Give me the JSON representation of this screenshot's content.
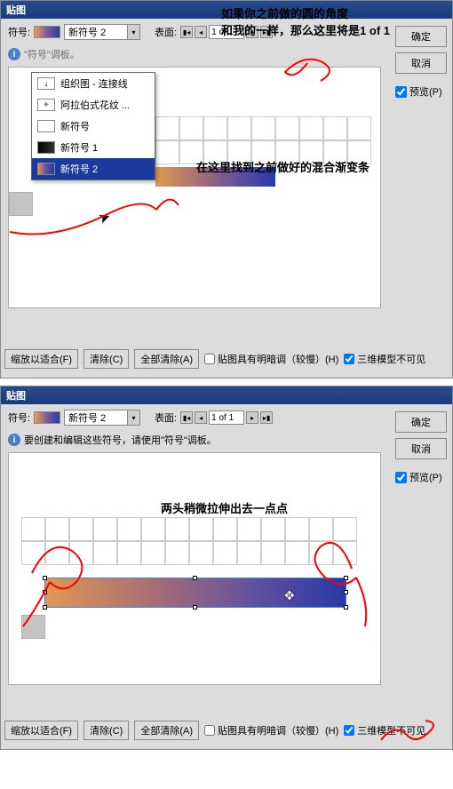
{
  "annotations": {
    "a1": "如果你之前做的圆的角度\n和我的一样，那么这里将是1 of 1",
    "a2": "在这里找到之前做好的混合渐变条",
    "a3": "两头稍微拉伸出去一点点"
  },
  "common": {
    "title": "贴图",
    "symbol_label": "符号:",
    "surface_label": "表面:",
    "surface_value": "1 of 1",
    "info_text": "要创建和编辑这些符号，请使用\"符号\"调板。",
    "ok": "确定",
    "cancel": "取消",
    "preview": "预览(P)",
    "fit": "缩放以适合(F)",
    "clear": "清除(C)",
    "clear_all": "全部清除(A)",
    "shade": "贴图具有明暗调（较慢）(H)",
    "invisible": "三维模型不可见"
  },
  "top": {
    "combo_value": "新符号 2",
    "dd_items": [
      {
        "label": "组织图 - 连接线",
        "thumb": "↓"
      },
      {
        "label": "阿拉伯式花纹 ...",
        "thumb": "✦"
      },
      {
        "label": "新符号",
        "thumb": ""
      },
      {
        "label": "新符号 1",
        "thumb": ""
      },
      {
        "label": "新符号 2",
        "thumb": ""
      }
    ]
  },
  "bottom": {
    "combo_value": "新符号 2"
  }
}
